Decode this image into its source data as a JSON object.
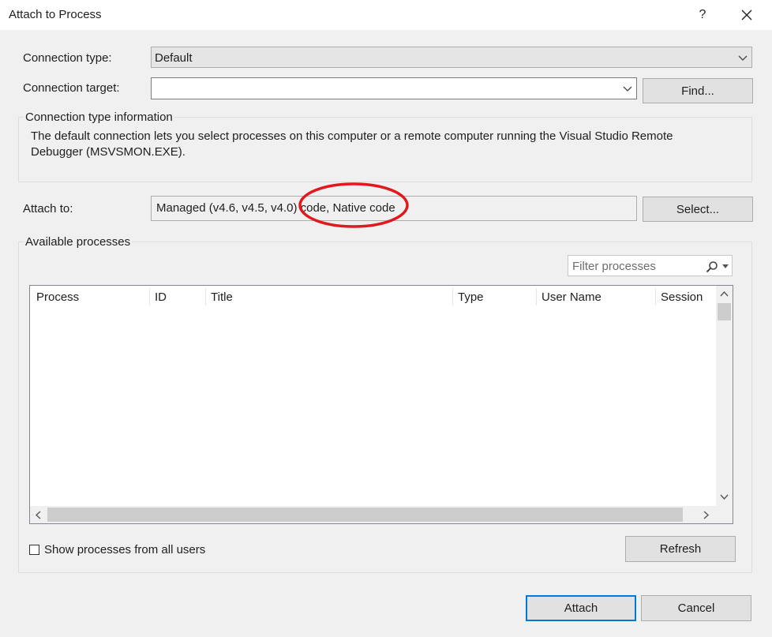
{
  "window": {
    "title": "Attach to Process",
    "help_label": "?"
  },
  "connection_type": {
    "label": "Connection type:",
    "value": "Default"
  },
  "connection_target": {
    "label": "Connection target:",
    "value": "",
    "find_button": "Find..."
  },
  "connection_info": {
    "caption": "Connection type information",
    "text": "The default connection lets you select processes on this computer or a remote computer running the Visual Studio Remote Debugger (MSVSMON.EXE)."
  },
  "attach_to": {
    "label": "Attach to:",
    "value": "Managed (v4.6, v4.5, v4.0) code, Native code",
    "select_button": "Select..."
  },
  "available_processes": {
    "caption": "Available processes",
    "filter_placeholder": "Filter processes",
    "columns": [
      "Process",
      "ID",
      "Title",
      "Type",
      "User Name",
      "Session"
    ],
    "show_all_users_label": "Show processes from all users",
    "show_all_users_checked": false,
    "refresh_button": "Refresh"
  },
  "footer": {
    "attach_button": "Attach",
    "cancel_button": "Cancel"
  },
  "annotation": {
    "color": "#e0191f"
  }
}
